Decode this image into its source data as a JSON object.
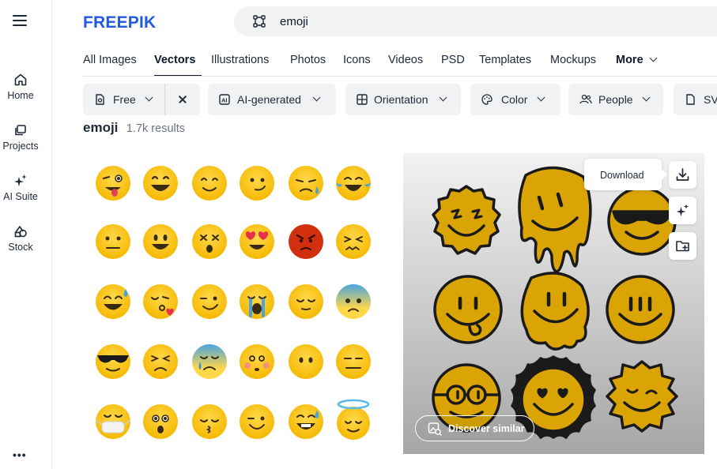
{
  "brand": {
    "logo_text": "FREEPIK",
    "color": "#1f5ae0"
  },
  "search": {
    "value": "emoji"
  },
  "rail": {
    "items": [
      {
        "label": "Home",
        "icon": "home-icon"
      },
      {
        "label": "Projects",
        "icon": "projects-icon"
      },
      {
        "label": "AI Suite",
        "icon": "sparkle-icon"
      },
      {
        "label": "Stock",
        "icon": "stock-icon"
      }
    ],
    "more": "•••"
  },
  "tabs": [
    {
      "label": "All Images"
    },
    {
      "label": "Vectors",
      "active": true
    },
    {
      "label": "Illustrations"
    },
    {
      "label": "Photos"
    },
    {
      "label": "Icons"
    },
    {
      "label": "Videos"
    },
    {
      "label": "PSD"
    },
    {
      "label": "Templates"
    },
    {
      "label": "Mockups"
    },
    {
      "label": "More"
    }
  ],
  "filters": {
    "free": "Free",
    "ai_generated": "AI-generated",
    "orientation": "Orientation",
    "color": "Color",
    "people": "People",
    "svg": "SVG"
  },
  "results": {
    "query": "emoji",
    "count": "1.7k results"
  },
  "card": {
    "download_tooltip": "Download",
    "discover_label": "Discover similar"
  },
  "colors": {
    "emoji_yellow": "#fcc419",
    "groovy_yellow": "#d9a404",
    "ink": "#0f1a2a"
  }
}
